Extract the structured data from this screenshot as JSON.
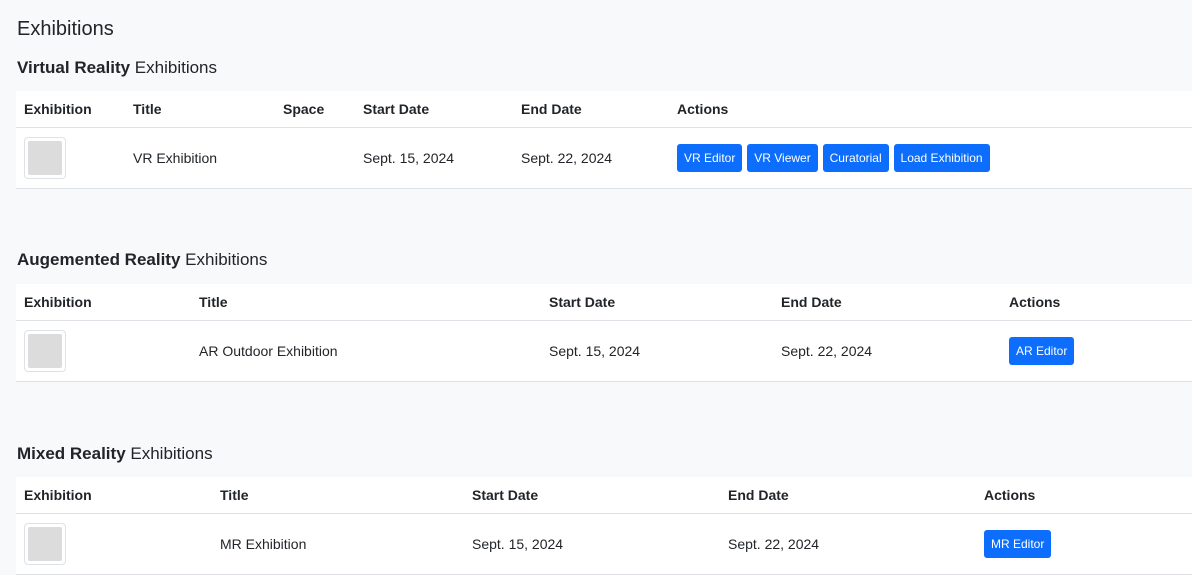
{
  "page_title": "Exhibitions",
  "sections": [
    {
      "title_bold": "Virtual Reality",
      "title_rest": " Exhibitions",
      "headers": [
        "Exhibition",
        "Title",
        "Space",
        "Start Date",
        "End Date",
        "Actions"
      ],
      "rows": [
        {
          "title": "VR Exhibition",
          "space": "",
          "start": "Sept. 15, 2024",
          "end": "Sept. 22, 2024",
          "actions": [
            "VR Editor",
            "VR Viewer",
            "Curatorial",
            "Load Exhibition"
          ]
        }
      ]
    },
    {
      "title_bold": "Augemented Reality",
      "title_rest": " Exhibitions",
      "headers": [
        "Exhibition",
        "Title",
        "Start Date",
        "End Date",
        "Actions"
      ],
      "rows": [
        {
          "title": "AR Outdoor Exhibition",
          "start": "Sept. 15, 2024",
          "end": "Sept. 22, 2024",
          "actions": [
            "AR Editor"
          ]
        }
      ]
    },
    {
      "title_bold": "Mixed Reality",
      "title_rest": " Exhibitions",
      "headers": [
        "Exhibition",
        "Title",
        "Start Date",
        "End Date",
        "Actions"
      ],
      "rows": [
        {
          "title": "MR Exhibition",
          "start": "Sept. 15, 2024",
          "end": "Sept. 22, 2024",
          "actions": [
            "MR Editor"
          ]
        }
      ]
    }
  ],
  "colors": {
    "accent": "#0d6efd",
    "background": "#f8f9fa",
    "table_bg": "#ffffff",
    "thumb_placeholder": "#dcdcdc"
  },
  "icons": {
    "exhibition_thumb": "image-placeholder-icon"
  }
}
